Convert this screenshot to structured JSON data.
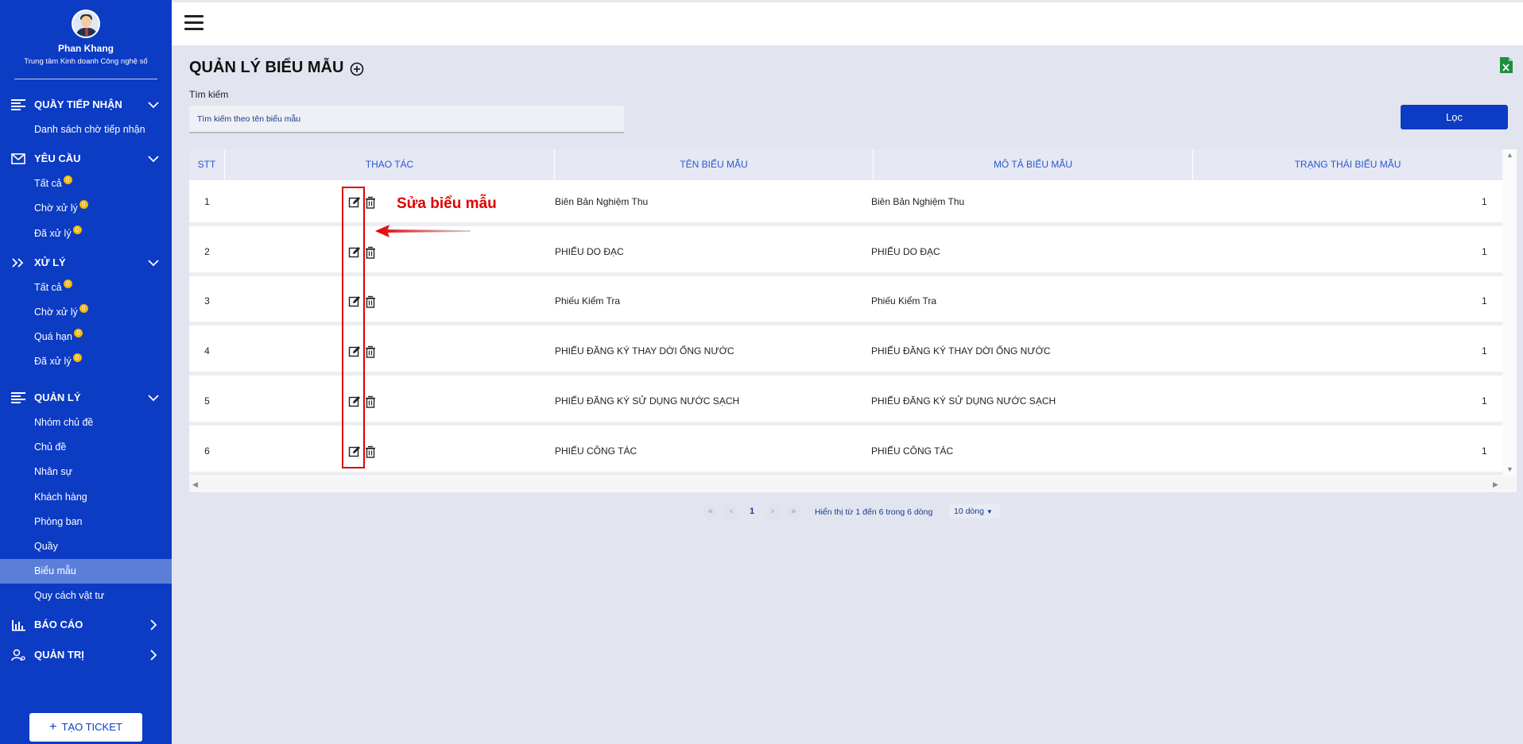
{
  "user": {
    "name": "Phan Khang",
    "department": "Trung tâm Kinh doanh Công nghệ số"
  },
  "sidebar": {
    "sections": [
      {
        "title": "QUẦY TIẾP NHẬN",
        "items": [
          {
            "label": "Danh sách chờ tiếp nhận"
          }
        ]
      },
      {
        "title": "YÊU CẦU",
        "items": [
          {
            "label": "Tất cả",
            "badge": "0"
          },
          {
            "label": "Chờ xử lý",
            "badge": "0"
          },
          {
            "label": "Đã xử lý",
            "badge": "0"
          }
        ]
      },
      {
        "title": "XỬ LÝ",
        "items": [
          {
            "label": "Tất cả",
            "badge": "0"
          },
          {
            "label": "Chờ xử lý",
            "badge": "0"
          },
          {
            "label": "Quá hạn",
            "badge": "0"
          },
          {
            "label": "Đã xử lý",
            "badge": "0"
          }
        ]
      },
      {
        "title": "QUẢN LÝ",
        "items": [
          {
            "label": "Nhóm chủ đề"
          },
          {
            "label": "Chủ đề"
          },
          {
            "label": "Nhân sự"
          },
          {
            "label": "Khách hàng"
          },
          {
            "label": "Phòng ban"
          },
          {
            "label": "Quầy"
          },
          {
            "label": "Biểu mẫu"
          },
          {
            "label": "Quy cách vật tư"
          }
        ]
      },
      {
        "title": "BÁO CÁO"
      },
      {
        "title": "QUẢN TRỊ"
      }
    ],
    "create_ticket": "TẠO TICKET"
  },
  "page": {
    "title": "QUẢN LÝ BIỂU MẪU",
    "search_label": "Tìm kiếm",
    "search_placeholder": "Tìm kiếm theo tên biểu mẫu",
    "filter_button": "Lọc"
  },
  "table": {
    "headers": [
      "STT",
      "THAO TÁC",
      "TÊN BIỂU MẪU",
      "MÔ TẢ BIỂU MẪU",
      "TRẠNG THÁI BIỂU MẪU"
    ],
    "rows": [
      {
        "stt": "1",
        "name": "Biên Bản Nghiệm Thu",
        "desc": "Biên Bản Nghiệm Thu",
        "status": "1"
      },
      {
        "stt": "2",
        "name": "PHIẾU DO ĐẠC",
        "desc": "PHIẾU DO ĐẠC",
        "status": "1"
      },
      {
        "stt": "3",
        "name": "Phiếu Kiểm Tra",
        "desc": "Phiếu Kiểm Tra",
        "status": "1"
      },
      {
        "stt": "4",
        "name": "PHIẾU ĐĂNG KÝ THAY DỜI ỐNG NƯỚC",
        "desc": "PHIẾU ĐĂNG KÝ THAY DỜI ỐNG NƯỚC",
        "status": "1"
      },
      {
        "stt": "5",
        "name": "PHIẾU ĐĂNG KÝ SỬ DỤNG NƯỚC SẠCH",
        "desc": "PHIẾU ĐĂNG KÝ SỬ DỤNG NƯỚC SẠCH",
        "status": "1"
      },
      {
        "stt": "6",
        "name": "PHIẾU CÔNG TÁC",
        "desc": "PHIẾU CÔNG TÁC",
        "status": "1"
      }
    ]
  },
  "annotation": {
    "text": "Sửa biểu mẫu",
    "color": "#e00000"
  },
  "pagination": {
    "first": "«",
    "prev": "‹",
    "current": "1",
    "next": "›",
    "last": "»",
    "info": "Hiển thị từ 1 đến 6 trong 6 dòng",
    "page_size": "10 dòng"
  },
  "colors": {
    "sidebar": "#0c3bc4",
    "active_item": "#5b7fd9",
    "badge": "#f5b800",
    "header_text": "#2b55d6"
  }
}
